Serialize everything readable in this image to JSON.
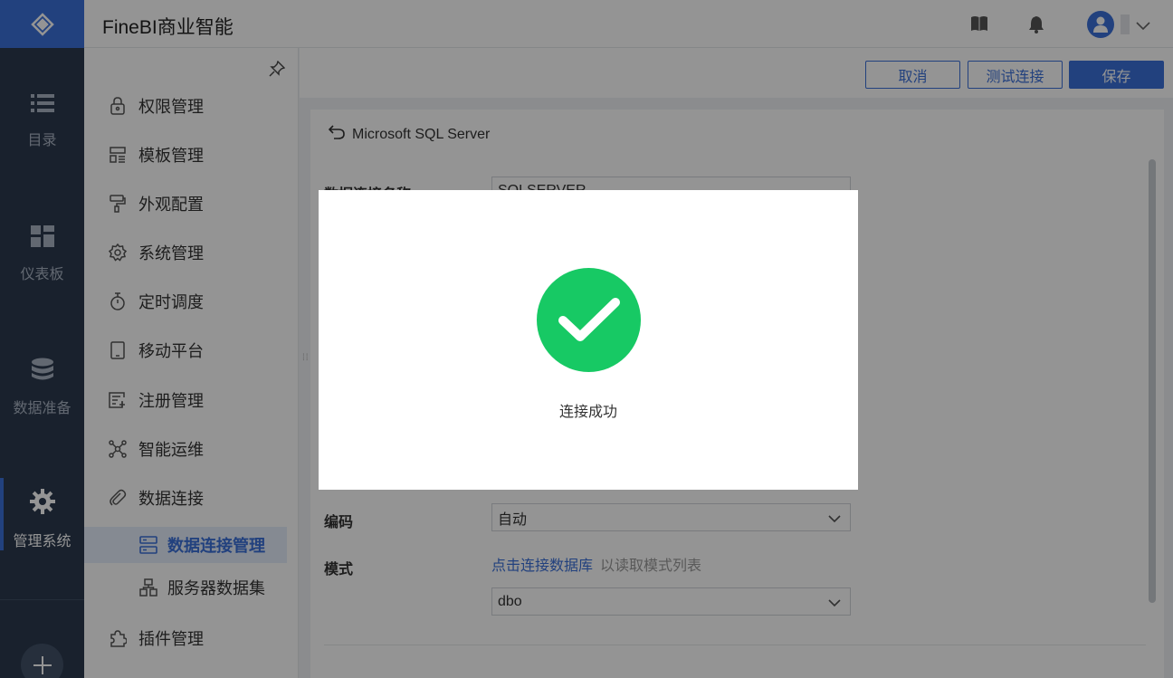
{
  "app": {
    "title": "FineBI商业智能"
  },
  "rail": {
    "items": [
      {
        "label": "目录",
        "icon": "list-icon"
      },
      {
        "label": "仪表板",
        "icon": "dashboard-icon"
      },
      {
        "label": "数据准备",
        "icon": "database-icon"
      },
      {
        "label": "管理系统",
        "icon": "gear-icon"
      }
    ]
  },
  "sidebar": {
    "items": [
      {
        "label": "权限管理",
        "icon": "lock-icon"
      },
      {
        "label": "模板管理",
        "icon": "template-icon"
      },
      {
        "label": "外观配置",
        "icon": "paint-roller-icon"
      },
      {
        "label": "系统管理",
        "icon": "settings-icon"
      },
      {
        "label": "定时调度",
        "icon": "timer-icon"
      },
      {
        "label": "移动平台",
        "icon": "tablet-icon"
      },
      {
        "label": "注册管理",
        "icon": "register-icon"
      },
      {
        "label": "智能运维",
        "icon": "network-icon"
      },
      {
        "label": "数据连接",
        "icon": "paperclip-icon"
      },
      {
        "label": "数据连接管理",
        "icon": "server-icon"
      },
      {
        "label": "服务器数据集",
        "icon": "dataset-icon"
      },
      {
        "label": "插件管理",
        "icon": "plugin-icon"
      }
    ]
  },
  "actions": {
    "cancel": "取消",
    "test": "测试连接",
    "save": "保存"
  },
  "connection": {
    "driver": "Microsoft SQL Server",
    "name_label": "数据连接名称",
    "name_value": "SQLSERVER",
    "encoding_label": "编码",
    "encoding_value": "自动",
    "schema_label": "模式",
    "schema_link": "点击连接数据库",
    "schema_hint": "以读取模式列表",
    "schema_value": "dbo"
  },
  "dialog": {
    "message": "连接成功"
  },
  "colors": {
    "brand": "#3b70d9",
    "success": "#17c964",
    "rail": "#2b3a4f"
  }
}
